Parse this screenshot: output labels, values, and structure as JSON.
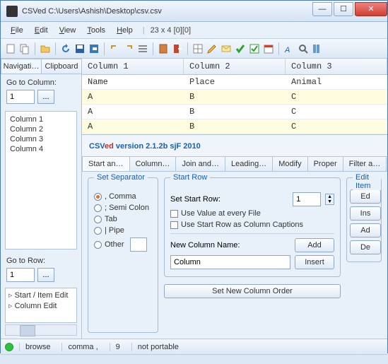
{
  "window": {
    "title": "CSVed C:\\Users\\Ashish\\Desktop\\csv.csv"
  },
  "menu": {
    "file": "File",
    "edit": "Edit",
    "view": "View",
    "tools": "Tools",
    "help": "Help",
    "info": "23 x 4 [0][0]"
  },
  "sidebar": {
    "tabs": [
      "Navigati…",
      "Clipboard"
    ],
    "gotoColLabel": "Go to Column:",
    "gotoColVal": "1",
    "columns": [
      "Column 1",
      "Column 2",
      "Column 3",
      "Column 4"
    ],
    "gotoRowLabel": "Go to Row:",
    "gotoRowVal": "1",
    "tree": [
      "Start / Item Edit",
      "Column Edit"
    ]
  },
  "grid": {
    "headers": [
      "Column 1",
      "Column 2",
      "Column 3"
    ],
    "rows": [
      [
        "Name",
        "Place",
        "Animal"
      ],
      [
        "A",
        "B",
        "C"
      ],
      [
        "A",
        "B",
        "C"
      ],
      [
        "A",
        "B",
        "C"
      ]
    ]
  },
  "brand": {
    "p1": "CSV",
    "p2": "ed",
    "p3": " version 2.1.2b sjF 2010"
  },
  "tabs": [
    "Start an…",
    "Column…",
    "Join and…",
    "Leading…",
    "Modify",
    "Proper",
    "Filter a…"
  ],
  "sep": {
    "legend": "Set Separator",
    "opts": [
      ", Comma",
      "; Semi Colon",
      "Tab",
      "| Pipe",
      "Other"
    ],
    "selected": 0
  },
  "startrow": {
    "legend": "Start Row",
    "setLabel": "Set Start Row:",
    "setVal": "1",
    "chk1": "Use Value at every File",
    "chk2": "Use Start Row as Column Captions",
    "newColLabel": "New Column Name:",
    "newColVal": "Column",
    "addBtn": "Add",
    "insertBtn": "Insert"
  },
  "editcol": {
    "legend": "Edit Item",
    "btns": [
      "Ed",
      "Ins",
      "Ad",
      "De"
    ]
  },
  "orderBtn": "Set New Column Order",
  "status": {
    "browse": "browse",
    "sep": "comma ,",
    "count": "9",
    "port": "not portable"
  }
}
